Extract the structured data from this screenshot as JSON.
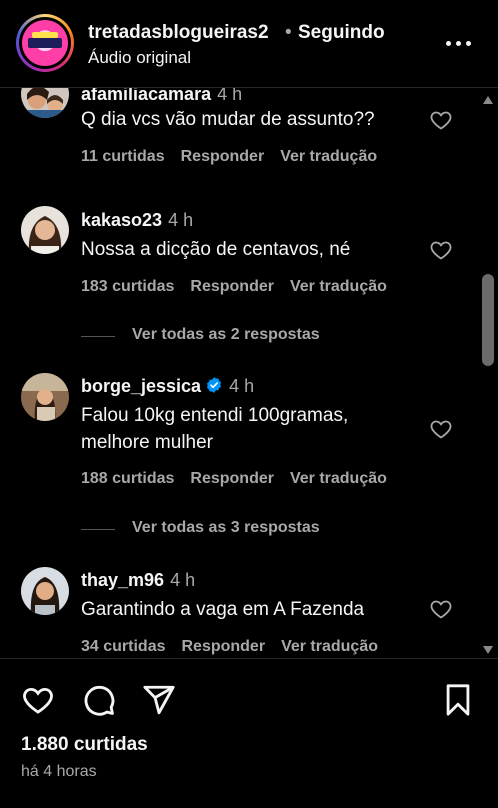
{
  "header": {
    "username": "tretadasblogueiras2",
    "separator": "•",
    "follow_status": "Seguindo",
    "audio": "Áudio original",
    "more_icon": "more-horizontal-icon"
  },
  "comments": [
    {
      "username": "afamiliacamara",
      "time": "4 h",
      "text": "Q dia vcs vão mudar de assunto??",
      "likes": "11 curtidas",
      "reply": "Responder",
      "translate": "Ver tradução"
    },
    {
      "username": "kakaso23",
      "time": "4 h",
      "text": "Nossa a dicção de centavos, né",
      "likes": "183 curtidas",
      "reply": "Responder",
      "translate": "Ver tradução",
      "replies": "Ver todas as 2 respostas"
    },
    {
      "username": "borge_jessica",
      "time": "4 h",
      "verified": true,
      "text": "Falou 10kg entendi 100gramas, melhore mulher",
      "likes": "188 curtidas",
      "reply": "Responder",
      "translate": "Ver tradução",
      "replies": "Ver todas as 3 respostas"
    },
    {
      "username": "thay_m96",
      "time": "4 h",
      "text": "Garantindo a vaga em A Fazenda",
      "likes": "34 curtidas",
      "reply": "Responder",
      "translate": "Ver tradução"
    }
  ],
  "footer": {
    "likes": "1.880 curtidas",
    "time_ago": "há 4 horas",
    "icons": [
      "heart-icon",
      "comment-icon",
      "share-icon",
      "bookmark-icon"
    ]
  },
  "colors": {
    "background": "#000000",
    "text": "#f5f5f5",
    "secondary": "#a8a8a8",
    "verified": "#0095f6"
  }
}
